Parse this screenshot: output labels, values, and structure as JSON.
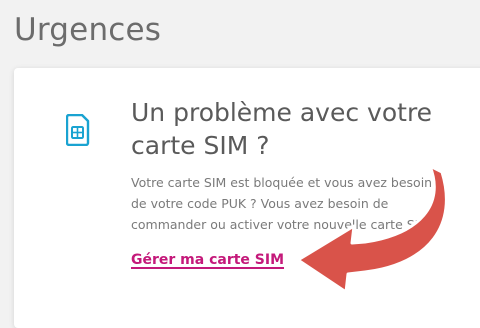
{
  "page": {
    "title": "Urgences"
  },
  "card": {
    "title": "Un problème avec votre carte SIM ?",
    "description": "Votre carte SIM est bloquée et vous avez besoin de votre code PUK ? Vous avez besoin de commander ou activer votre nouvelle carte SIM ?",
    "link_label": "Gérer ma carte SIM",
    "icon": "sim-card-icon"
  },
  "colors": {
    "accent": "#c4197a",
    "icon": "#1aa3d1",
    "arrow": "#d9534a"
  }
}
